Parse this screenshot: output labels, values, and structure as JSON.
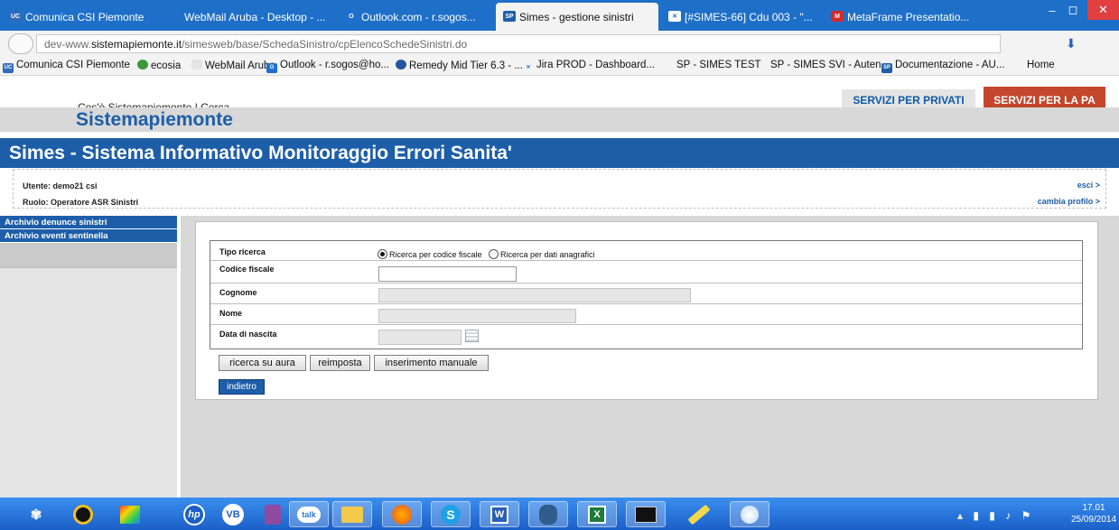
{
  "browser": {
    "tabs": [
      {
        "label": "Comunica CSI Piemonte",
        "icon": "uc-icon",
        "active": false
      },
      {
        "label": "WebMail Aruba - Desktop - ...",
        "icon": "none",
        "active": false
      },
      {
        "label": "Outlook.com - r.sogos...",
        "icon": "outlook-icon",
        "active": false
      },
      {
        "label": "Simes - gestione sinistri",
        "icon": "sp-icon",
        "active": true
      },
      {
        "label": "[#SIMES-66] Cdu 003 - \"...",
        "icon": "jira-icon",
        "active": false
      },
      {
        "label": "MetaFrame Presentatio...",
        "icon": "citrix-icon",
        "active": false
      }
    ],
    "window_controls": [
      "–",
      "◻",
      "✕"
    ],
    "url_prefix": "dev-www.",
    "url_domain": "sistemapiemonte.it",
    "url_path": "/simesweb/base/SchedaSinistro/cpElencoSchedeSinistri.do",
    "bookmarks": [
      "Comunica CSI Piemonte",
      "ecosia",
      "WebMail Aruba",
      "Outlook - r.sogos@ho...",
      "Remedy Mid Tier 6.3 - ...",
      "Jira PROD - Dashboard...",
      "SP - SIMES TEST",
      "SP - SIMES SVI - Auten...",
      "Documentazione - AU...",
      "Home"
    ]
  },
  "site": {
    "top_nav": {
      "link_about": "Cos'è Sistemapiemonte",
      "separator": "|",
      "link_search": "Cerca"
    },
    "btn_privati": "SERVIZI PER PRIVATI",
    "btn_pa": "SERVIZI PER LA PA",
    "brand": "Sistemapiemonte",
    "app_title": "Simes - Sistema Informativo Monitoraggio Errori Sanita'",
    "user": {
      "utente": "Utente: demo21 csi",
      "ruolo": "Ruolo: Operatore ASR Sinistri",
      "esci": "esci >",
      "cambia": "cambia profilo >"
    },
    "sidebar": [
      "Archivio denunce sinistri",
      "Archivio eventi sentinella"
    ]
  },
  "form": {
    "tipo_ricerca_label": "Tipo ricerca",
    "radio_cf_label": "Ricerca per codice fiscale",
    "radio_dati_label": "Ricerca per dati anagrafici",
    "radio_selected": "codice_fiscale",
    "codice_fiscale_label": "Codice fiscale",
    "codice_fiscale_value": "",
    "cognome_label": "Cognome",
    "cognome_value": "",
    "nome_label": "Nome",
    "nome_value": "",
    "data_nascita_label": "Data di nascita",
    "data_nascita_value": "",
    "btn_ricerca": "ricerca su aura",
    "btn_reimposta": "reimposta",
    "btn_inserimento": "inserimento manuale",
    "btn_indietro": "indietro"
  },
  "taskbar": {
    "apps": [
      "pinwheel-icon",
      "media-icon",
      "paint-icon",
      "hp-icon",
      "vb-icon",
      "database-icon",
      "talk-icon",
      "folder-icon",
      "firefox-icon",
      "skype-icon",
      "word-icon",
      "pgadmin-icon",
      "excel-icon",
      "terminal-icon",
      "pencil-icon",
      "paint-brush-icon"
    ],
    "time": "17.01",
    "date": "25/09/2014"
  },
  "colors": {
    "brand_blue": "#1d5ea9",
    "pa_red": "#c4472b",
    "tab_blue": "#1e6fc8"
  }
}
